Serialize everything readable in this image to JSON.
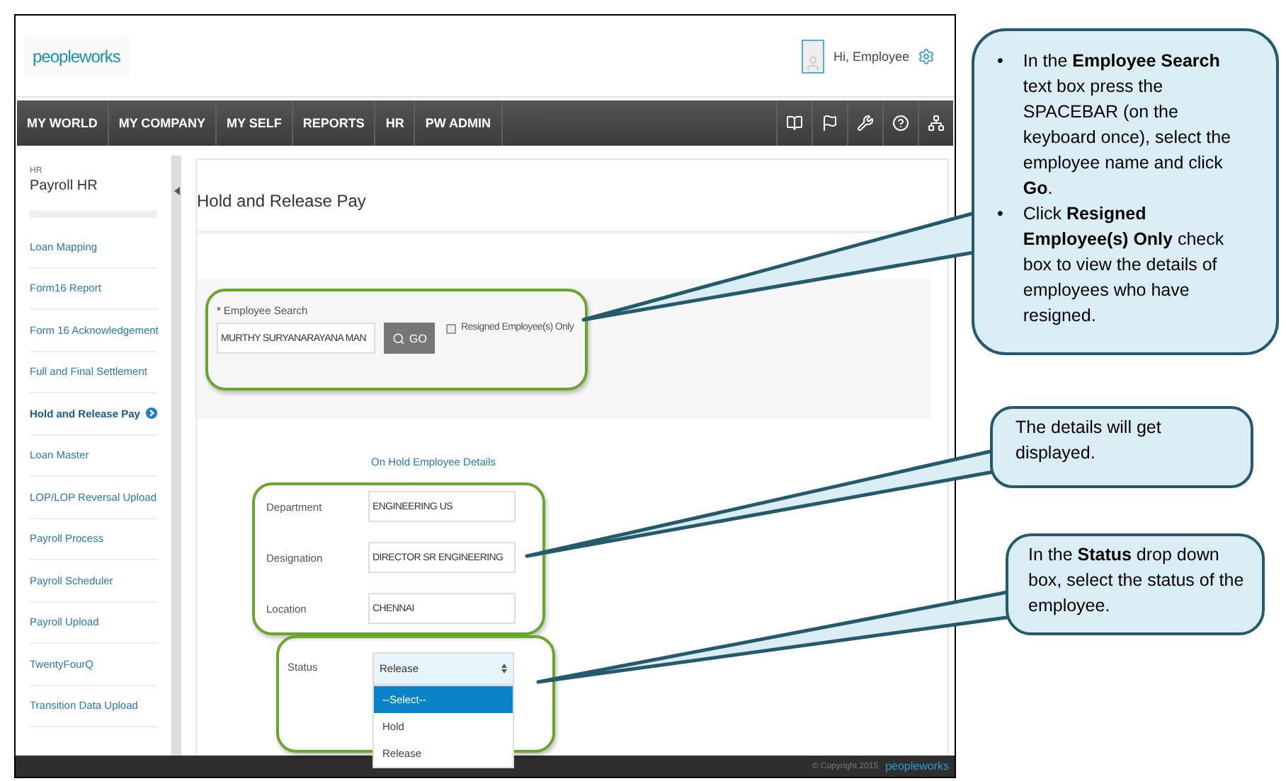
{
  "app": {
    "logo": "peopleworks",
    "greeting": "Hi, Employee"
  },
  "nav": {
    "items": [
      {
        "label": "MY WORLD"
      },
      {
        "label": "MY COMPANY"
      },
      {
        "label": "MY SELF"
      },
      {
        "label": "REPORTS"
      },
      {
        "label": "HR"
      },
      {
        "label": "PW ADMIN"
      }
    ]
  },
  "sidebar": {
    "section": "HR",
    "title": "Payroll HR",
    "items": [
      {
        "label": "Loan Mapping",
        "selected": false
      },
      {
        "label": "Form16 Report",
        "selected": false
      },
      {
        "label": "Form 16 Acknowledgement",
        "selected": false
      },
      {
        "label": "Full and Final Settlement",
        "selected": false
      },
      {
        "label": "Hold and Release Pay",
        "selected": true
      },
      {
        "label": "Loan Master",
        "selected": false
      },
      {
        "label": "LOP/LOP Reversal Upload",
        "selected": false
      },
      {
        "label": "Payroll Process",
        "selected": false
      },
      {
        "label": "Payroll Scheduler",
        "selected": false
      },
      {
        "label": "Payroll Upload",
        "selected": false
      },
      {
        "label": "TwentyFourQ",
        "selected": false
      },
      {
        "label": "Transition Data Upload",
        "selected": false
      }
    ]
  },
  "page": {
    "title": "Hold and Release Pay"
  },
  "search": {
    "label": "Employee Search",
    "required_mark": "*",
    "value": "MURTHY SURYANARAYANA MAN",
    "button": "GO",
    "checkbox": {
      "label": "Resigned Employee(s) Only",
      "checked": false
    }
  },
  "details": {
    "heading": "On Hold Employee Details",
    "fields": [
      {
        "label": "Department",
        "value": "ENGINEERING US"
      },
      {
        "label": "Designation",
        "value": "DIRECTOR SR ENGINEERING"
      },
      {
        "label": "Location",
        "value": "CHENNAI"
      }
    ],
    "status": {
      "label": "Status",
      "value": "Release",
      "expanded": true,
      "options": [
        {
          "label": "--Select--",
          "highlighted": true
        },
        {
          "label": "Hold",
          "highlighted": false
        },
        {
          "label": "Release",
          "highlighted": false
        }
      ]
    }
  },
  "footer": {
    "copyright": "© Copyright 2015",
    "logo": "peopleworks"
  },
  "callouts": [
    {
      "kind": "bullets",
      "bullet": "•",
      "items": [
        "In the **Employee Search** text box press the SPACEBAR  (on the keyboard once), select the employee name and click **Go**.",
        "Click **Resigned Employee(s) Only** check box to view the details of employees who have resigned."
      ]
    },
    {
      "kind": "text",
      "text": "The details will get displayed."
    },
    {
      "kind": "text",
      "text": "In the **Status** drop down box, select the status of the employee."
    }
  ]
}
